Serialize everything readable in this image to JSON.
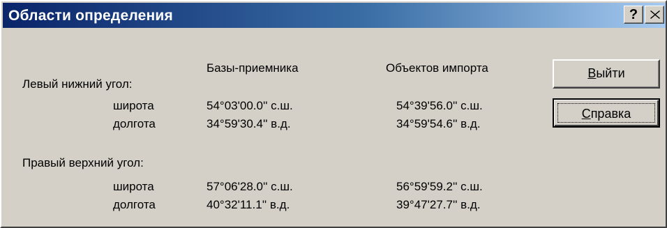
{
  "window": {
    "title": "Области определения",
    "help_glyph": "?",
    "close_icon": "close-x-icon"
  },
  "columns": {
    "base": "Базы-приемника",
    "import": "Объектов импорта"
  },
  "sections": [
    {
      "label": "Левый нижний угол:",
      "rows": [
        {
          "label": "широта",
          "base": "54°03'00.0'' с.ш.",
          "import": "54°39'56.0'' с.ш."
        },
        {
          "label": "долгота",
          "base": "34°59'30.4'' в.д.",
          "import": "34°59'54.6'' в.д."
        }
      ]
    },
    {
      "label": "Правый верхний угол:",
      "rows": [
        {
          "label": "широта",
          "base": "57°06'28.0'' с.ш.",
          "import": "56°59'59.2'' с.ш."
        },
        {
          "label": "долгота",
          "base": "40°32'11.1'' в.д.",
          "import": "39°47'27.7'' в.д."
        }
      ]
    }
  ],
  "buttons": {
    "exit_accel": "В",
    "exit_rest": "ыйти",
    "help_accel": "С",
    "help_rest": "правка"
  },
  "colors": {
    "titlebar_start": "#0a246a",
    "titlebar_end": "#a6caf0",
    "face": "#d4d0c8"
  }
}
